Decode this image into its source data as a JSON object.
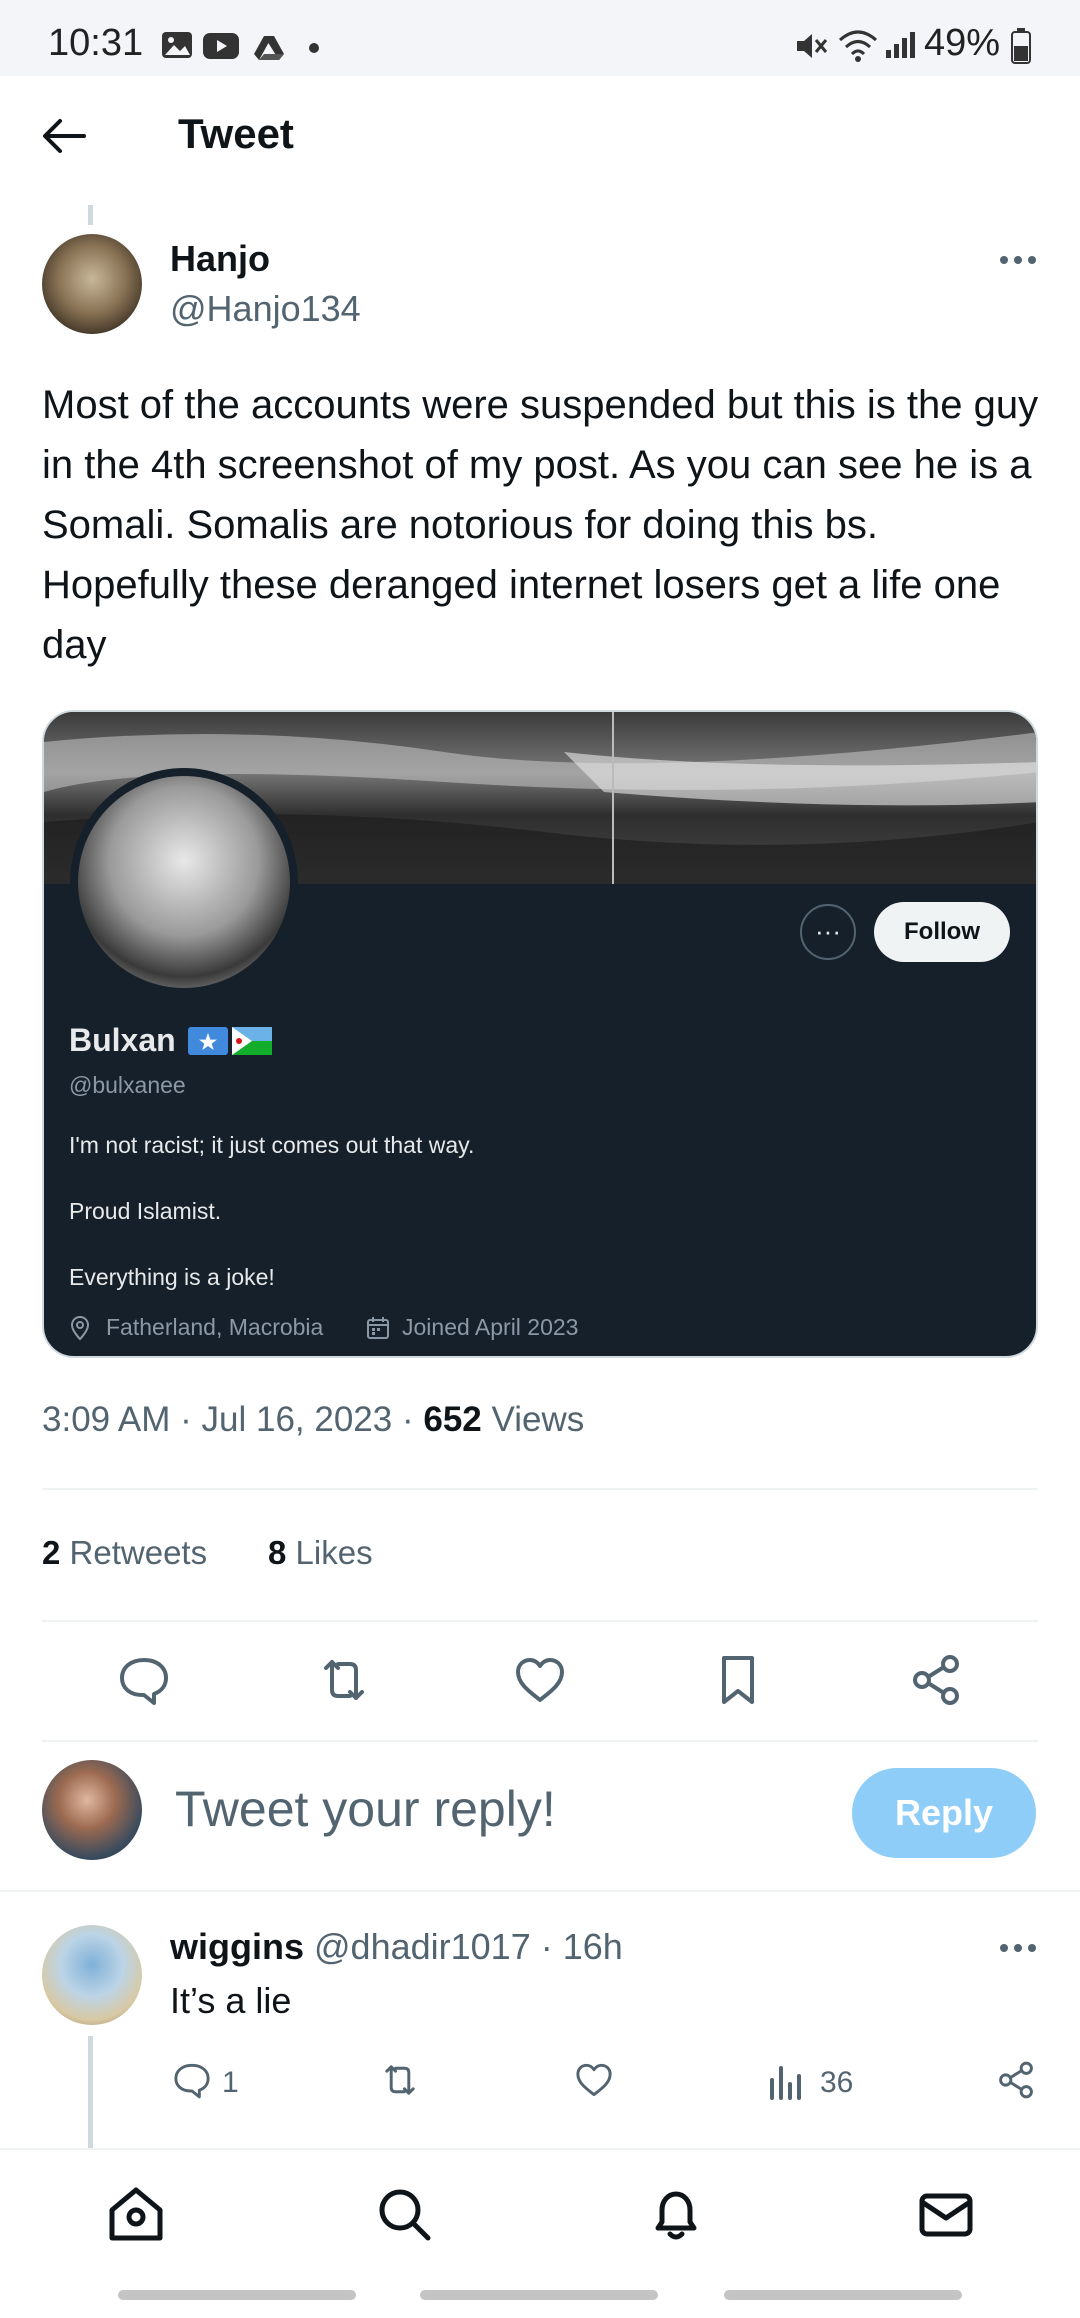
{
  "status_bar": {
    "time": "10:31",
    "battery": "49%"
  },
  "header": {
    "title": "Tweet"
  },
  "tweet": {
    "author_name": "Hanjo",
    "author_handle": "@Hanjo134",
    "text": "Most of the accounts were suspended but this is the guy in the 4th screenshot of my post. As you can see he is a Somali. Somalis are notorious for doing this bs. Hopefully these deranged internet losers get a life one day",
    "time": "3:09 AM",
    "date": "Jul 16, 2023",
    "views_count": "652",
    "views_label": "Views",
    "retweets_count": "2",
    "retweets_label": "Retweets",
    "likes_count": "8",
    "likes_label": "Likes"
  },
  "card": {
    "name": "Bulxan",
    "handle": "@bulxanee",
    "follow_label": "Follow",
    "more_label": "···",
    "bio_1": "I'm not racist; it just comes out that way.",
    "bio_2": "Proud Islamist.",
    "bio_3": "Everything is a joke!",
    "location": "Fatherland, Macrobia",
    "joined": "Joined April 2023"
  },
  "composer": {
    "placeholder": "Tweet your reply!",
    "reply_label": "Reply"
  },
  "reply": {
    "author_name": "wiggins",
    "author_handle": "@dhadir1017",
    "time": "· 16h",
    "text": "It’s a lie",
    "reply_count": "1",
    "views_count": "36"
  },
  "colors": {
    "accent": "#1d9bf0",
    "reply_button": "#8ecdf8",
    "card_bg": "#15202b"
  }
}
